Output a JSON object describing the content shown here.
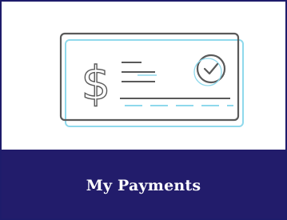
{
  "tile": {
    "label": "My Payments",
    "icon": "check-payment-icon",
    "colors": {
      "label_bar": "#221c6b",
      "label_text": "#ffffff",
      "icon_stroke": "#555555",
      "icon_accent": "#7fd6ea",
      "border": "#1e1c6b"
    }
  }
}
